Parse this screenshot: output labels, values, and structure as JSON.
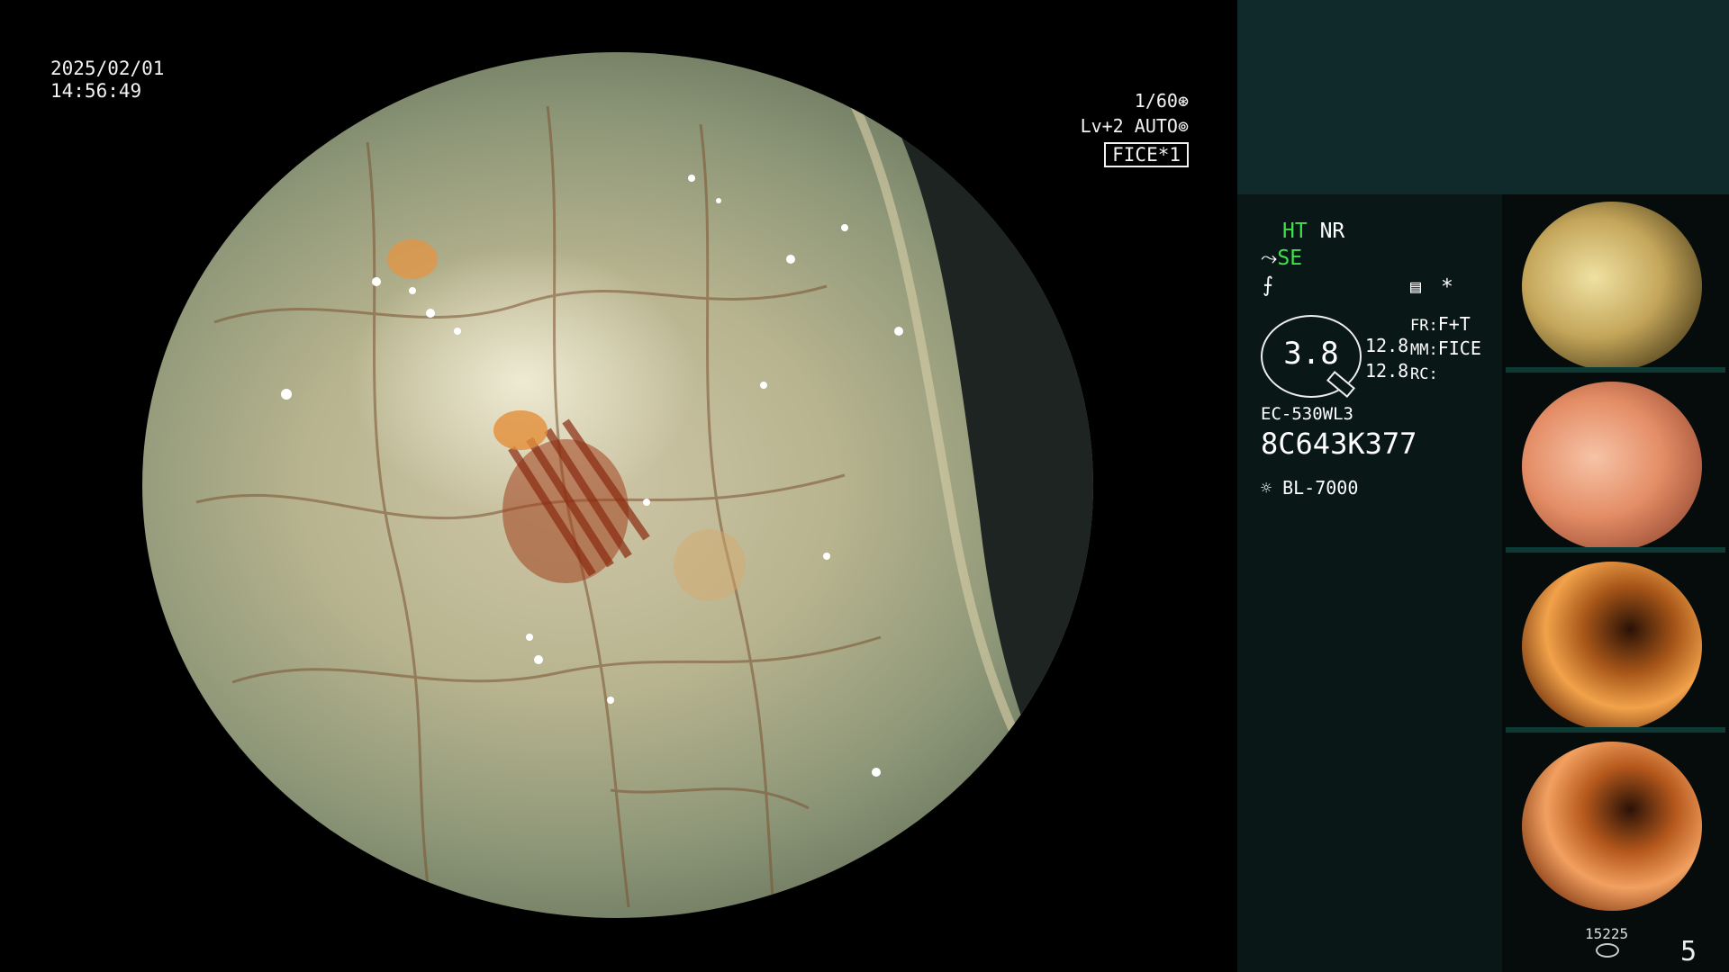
{
  "datetime": {
    "date": "2025/02/01",
    "time": "14:56:49"
  },
  "status": {
    "shutter": "1/60",
    "shutter_icon": "shutter-icon",
    "level": "Lv+2",
    "mode": "AUTO",
    "mode_icon": "iris-icon",
    "fice": "FICE*1"
  },
  "panel": {
    "ht": "HT",
    "nr": "NR",
    "se": "SE",
    "se_icon": "sharpness-icon",
    "fx_icon": "tone-curve-icon",
    "memo_icon": "memo-icon",
    "asterisk": "*",
    "gauge_value": "3.8",
    "readout_1": "12.8",
    "readout_2": "12.8",
    "fr_label": "FR:",
    "fr_value": "F+T",
    "mm_label": "MM:",
    "mm_value": "FICE",
    "rc_label": "RC:",
    "scope_model": "EC-530WL3",
    "serial": "8C643K377",
    "light_icon": "light-source-icon",
    "light_source": "BL-7000"
  },
  "footer": {
    "count": "15225",
    "page": "5"
  },
  "colors": {
    "top_panel": "#10292a",
    "info_panel": "#091816",
    "accent_green": "#3fe04c"
  }
}
